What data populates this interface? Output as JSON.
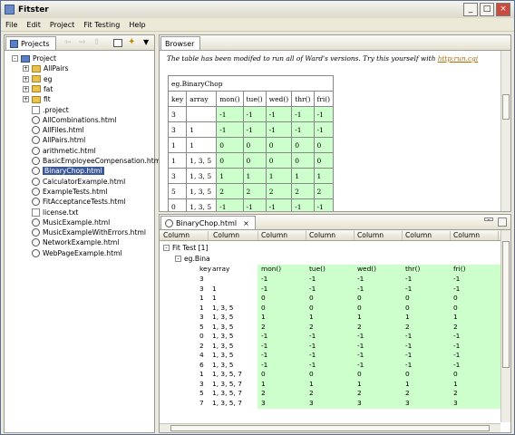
{
  "window": {
    "title": "Fitster",
    "min": "_",
    "max": "□",
    "close": "×"
  },
  "menu": [
    "File",
    "Edit",
    "Project",
    "Fit Testing",
    "Help"
  ],
  "projects": {
    "tab": "Projects",
    "tree": [
      {
        "label": "Project",
        "type": "project",
        "indent": 0,
        "exp": "-"
      },
      {
        "label": "AllPairs",
        "type": "folder",
        "indent": 1,
        "exp": "+"
      },
      {
        "label": "eg",
        "type": "folder",
        "indent": 1,
        "exp": "+"
      },
      {
        "label": "fat",
        "type": "folder",
        "indent": 1,
        "exp": "+"
      },
      {
        "label": "fit",
        "type": "folder",
        "indent": 1,
        "exp": "+"
      },
      {
        "label": ".project",
        "type": "plain",
        "indent": 1
      },
      {
        "label": "AllCombinations.html",
        "type": "file",
        "indent": 1
      },
      {
        "label": "AllFiles.html",
        "type": "file",
        "indent": 1
      },
      {
        "label": "AllPairs.html",
        "type": "file",
        "indent": 1
      },
      {
        "label": "arithmetic.html",
        "type": "file",
        "indent": 1
      },
      {
        "label": "BasicEmployeeCompensation.html",
        "type": "file",
        "indent": 1
      },
      {
        "label": "BinaryChop.html",
        "type": "file",
        "indent": 1,
        "selected": true
      },
      {
        "label": "CalculatorExample.html",
        "type": "file",
        "indent": 1
      },
      {
        "label": "ExampleTests.html",
        "type": "file",
        "indent": 1
      },
      {
        "label": "FitAcceptanceTests.html",
        "type": "file",
        "indent": 1
      },
      {
        "label": "license.txt",
        "type": "plain",
        "indent": 1
      },
      {
        "label": "MusicExample.html",
        "type": "file",
        "indent": 1
      },
      {
        "label": "MusicExampleWithErrors.html",
        "type": "file",
        "indent": 1
      },
      {
        "label": "NetworkExample.html",
        "type": "file",
        "indent": 1
      },
      {
        "label": "WebPageExample.html",
        "type": "file",
        "indent": 1
      }
    ]
  },
  "browser": {
    "tab": "Browser",
    "note": "The table has been modifed to run all of Ward's versions. Try this yourself with ",
    "link": "http:run.cgi",
    "fixture": "eg.BinaryChop",
    "headers": [
      "key",
      "array",
      "mon()",
      "tue()",
      "wed()",
      "thr()",
      "fri()"
    ],
    "rows": [
      [
        "3",
        "",
        "-1",
        "-1",
        "-1",
        "-1",
        "-1"
      ],
      [
        "3",
        "1",
        "-1",
        "-1",
        "-1",
        "-1",
        "-1"
      ],
      [
        "1",
        "1",
        "0",
        "0",
        "0",
        "0",
        "0"
      ],
      [
        "1",
        "1, 3, 5",
        "0",
        "0",
        "0",
        "0",
        "0"
      ],
      [
        "3",
        "1, 3, 5",
        "1",
        "1",
        "1",
        "1",
        "1"
      ],
      [
        "5",
        "1, 3, 5",
        "2",
        "2",
        "2",
        "2",
        "2"
      ],
      [
        "0",
        "1, 3, 5",
        "-1",
        "-1",
        "-1",
        "-1",
        "-1"
      ]
    ]
  },
  "results": {
    "tab": "BinaryChop.html",
    "columns": [
      "Column",
      "Column",
      "Column",
      "Column",
      "Column",
      "Column",
      "Column"
    ],
    "fit_test": "Fit Test [1]",
    "fixture": "eg.Bina",
    "headers": [
      "key",
      "array",
      "mon()",
      "tue()",
      "wed()",
      "thr()",
      "fri()"
    ],
    "rows": [
      [
        "3",
        "",
        "-1",
        "-1",
        "-1",
        "-1",
        "-1"
      ],
      [
        "3",
        "1",
        "-1",
        "-1",
        "-1",
        "-1",
        "-1"
      ],
      [
        "1",
        "1",
        "0",
        "0",
        "0",
        "0",
        "0"
      ],
      [
        "1",
        "1, 3, 5",
        "0",
        "0",
        "0",
        "0",
        "0"
      ],
      [
        "3",
        "1, 3, 5",
        "1",
        "1",
        "1",
        "1",
        "1"
      ],
      [
        "5",
        "1, 3, 5",
        "2",
        "2",
        "2",
        "2",
        "2"
      ],
      [
        "0",
        "1, 3, 5",
        "-1",
        "-1",
        "-1",
        "-1",
        "-1"
      ],
      [
        "2",
        "1, 3, 5",
        "-1",
        "-1",
        "-1",
        "-1",
        "-1"
      ],
      [
        "4",
        "1, 3, 5",
        "-1",
        "-1",
        "-1",
        "-1",
        "-1"
      ],
      [
        "6",
        "1, 3, 5",
        "-1",
        "-1",
        "-1",
        "-1",
        "-1"
      ],
      [
        "1",
        "1, 3, 5, 7",
        "0",
        "0",
        "0",
        "0",
        "0"
      ],
      [
        "3",
        "1, 3, 5, 7",
        "1",
        "1",
        "1",
        "1",
        "1"
      ],
      [
        "5",
        "1, 3, 5, 7",
        "2",
        "2",
        "2",
        "2",
        "2"
      ],
      [
        "7",
        "1, 3, 5, 7",
        "3",
        "3",
        "3",
        "3",
        "3"
      ]
    ]
  },
  "colors": {
    "pass": "#ccffcc",
    "selection": "#3b5998"
  }
}
